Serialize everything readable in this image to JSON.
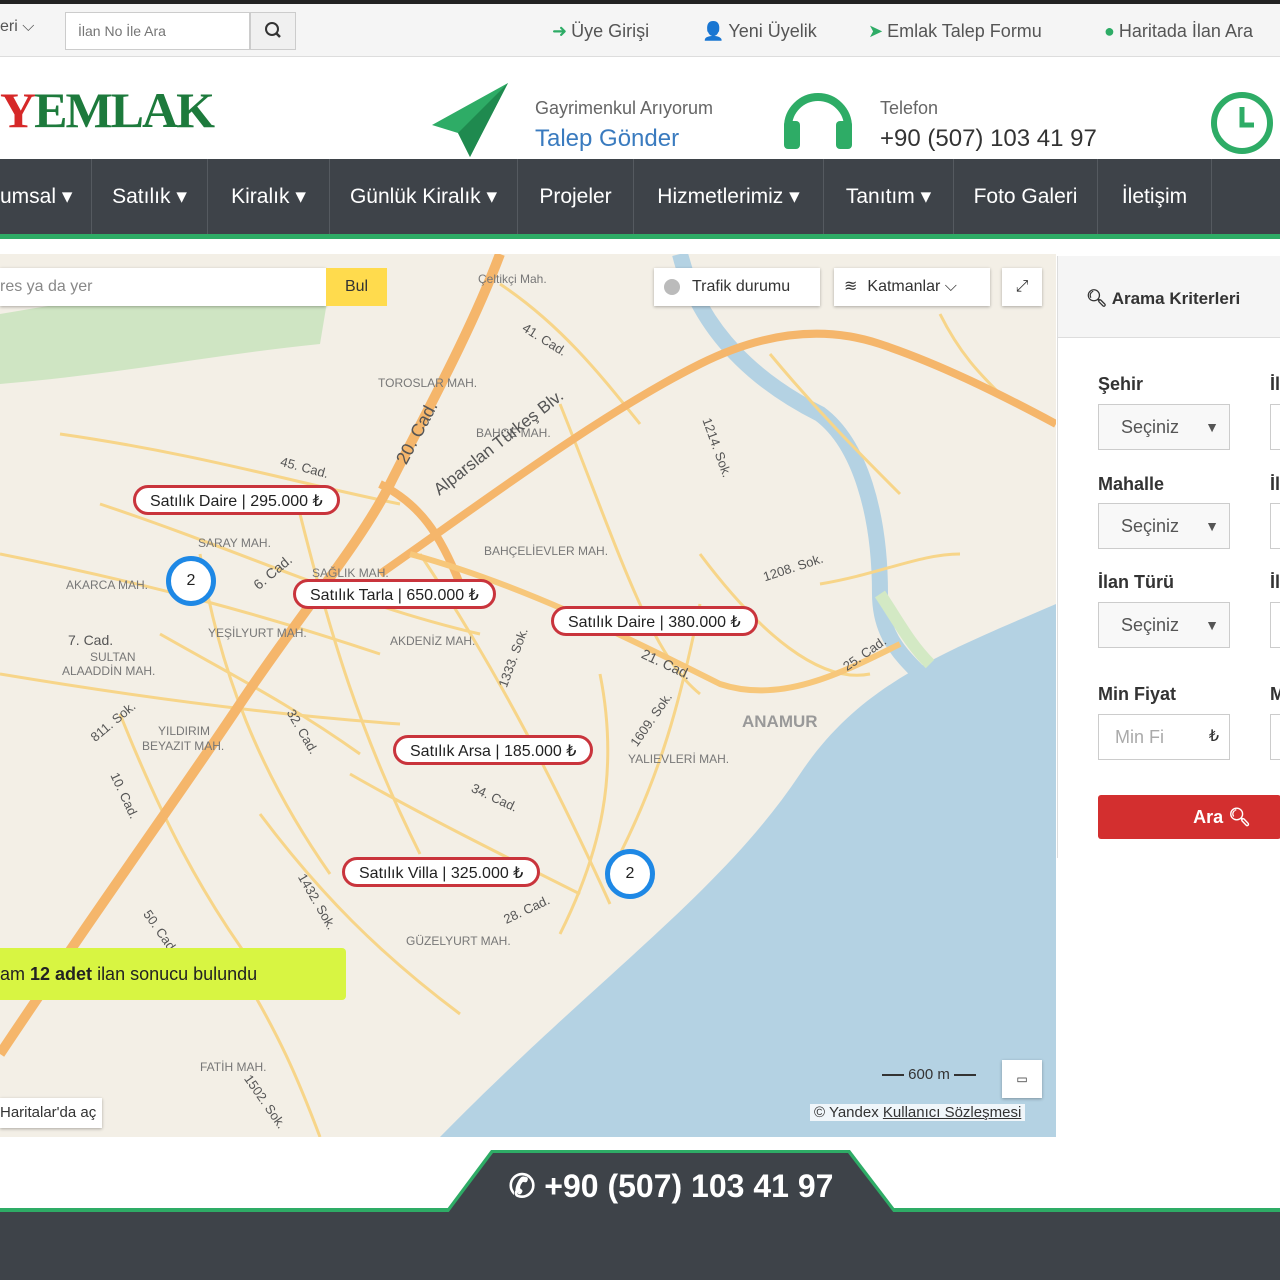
{
  "topbar": {
    "lang_label": "eri",
    "search_placeholder": "İlan No İle Ara",
    "links": {
      "login": "Üye Girişi",
      "register": "Yeni Üyelik",
      "request_form": "Emlak Talep Formu",
      "map_search": "Haritada İlan Ara"
    }
  },
  "header": {
    "logo_accent": "Y",
    "logo_text": "EMLAK",
    "request_small": "Gayrimenkul Arıyorum",
    "request_big": "Talep Gönder",
    "phone_small": "Telefon",
    "phone_big": "+90 (507) 103 41 97"
  },
  "nav": {
    "items": [
      "umsal",
      "Satılık",
      "Kiralık",
      "Günlük Kiralık",
      "Projeler",
      "Hizmetlerimiz",
      "Tanıtım",
      "Foto Galeri",
      "İletişim"
    ]
  },
  "map": {
    "search_placeholder": "res ya da yer",
    "search_button": "Bul",
    "traffic": "Trafik durumu",
    "layers": "Katmanlar",
    "markers": [
      "Satılık Daire | 295.000 ₺",
      "Satılık Tarla | 650.000 ₺",
      "Satılık Daire | 380.000 ₺",
      "Satılık Arsa | 185.000 ₺",
      "Satılık Villa | 325.000 ₺"
    ],
    "clusters": [
      "2",
      "2"
    ],
    "labels": {
      "celtikci": "Çeltikçi Mah.",
      "toroslar": "TOROSLAR MAH.",
      "bahce": "BAHÇE MAH.",
      "bahcelievler": "BAHÇELİEVLER MAH.",
      "saray": "SARAY MAH.",
      "sagl": "SAĞLIK MAH.",
      "akarca": "AKARCA MAH.",
      "yesilyurt": "YEŞİLYURT MAH.",
      "akdeniz": "AKDENİZ MAH.",
      "sultan": "SULTAN",
      "alaaddin": "ALAADDİN MAH.",
      "yildirim": "YILDIRIM",
      "beyazit": "BEYAZIT MAH.",
      "yalievleri": "YALIEVLERİ MAH.",
      "guzelyurt": "GÜZELYURT MAH.",
      "fatih": "FATİH MAH.",
      "anamur": "ANAMUR",
      "alparslan": "Alparslan Türkeş Blv.",
      "c20": "20. Cad.",
      "c41": "41. Cad.",
      "c45": "45. Cad.",
      "c6": "6. Cad.",
      "c7": "7. Cad.",
      "c21": "21. Cad.",
      "c25": "25. Cad.",
      "c34": "34. Cad.",
      "c28": "28. Cad.",
      "c32": "32. Cad.",
      "c10": "10. Cad.",
      "c50": "50. Cad.",
      "s1214": "1214. Sok.",
      "s1208": "1208. Sok.",
      "s1333": "1333. Sok.",
      "s1609": "1609. Sok.",
      "s1432": "1432. Sok.",
      "s811": "811. Sok.",
      "s1502": "1502. Sok."
    },
    "scale": "600 m",
    "copyright": "© Yandex",
    "terms": "Kullanıcı Sözleşmesi",
    "open_in": "Haritalar'da aç",
    "result_prefix": "am ",
    "result_count": "12 adet",
    "result_suffix": " ilan sonucu bulundu"
  },
  "panel": {
    "title": "Arama Kriterleri",
    "city_label": "Şehir",
    "neighborhood_label": "Mahalle",
    "type_label": "İlan Türü",
    "min_price_label": "Min Fiyat",
    "select_default": "Seçiniz",
    "min_price_placeholder": "Min Fi",
    "currency": "₺",
    "cut_labels": [
      "İl",
      "İl",
      "İl",
      "M"
    ],
    "search_button": "Ara"
  },
  "footer": {
    "phone": "+90 (507) 103 41 97"
  }
}
